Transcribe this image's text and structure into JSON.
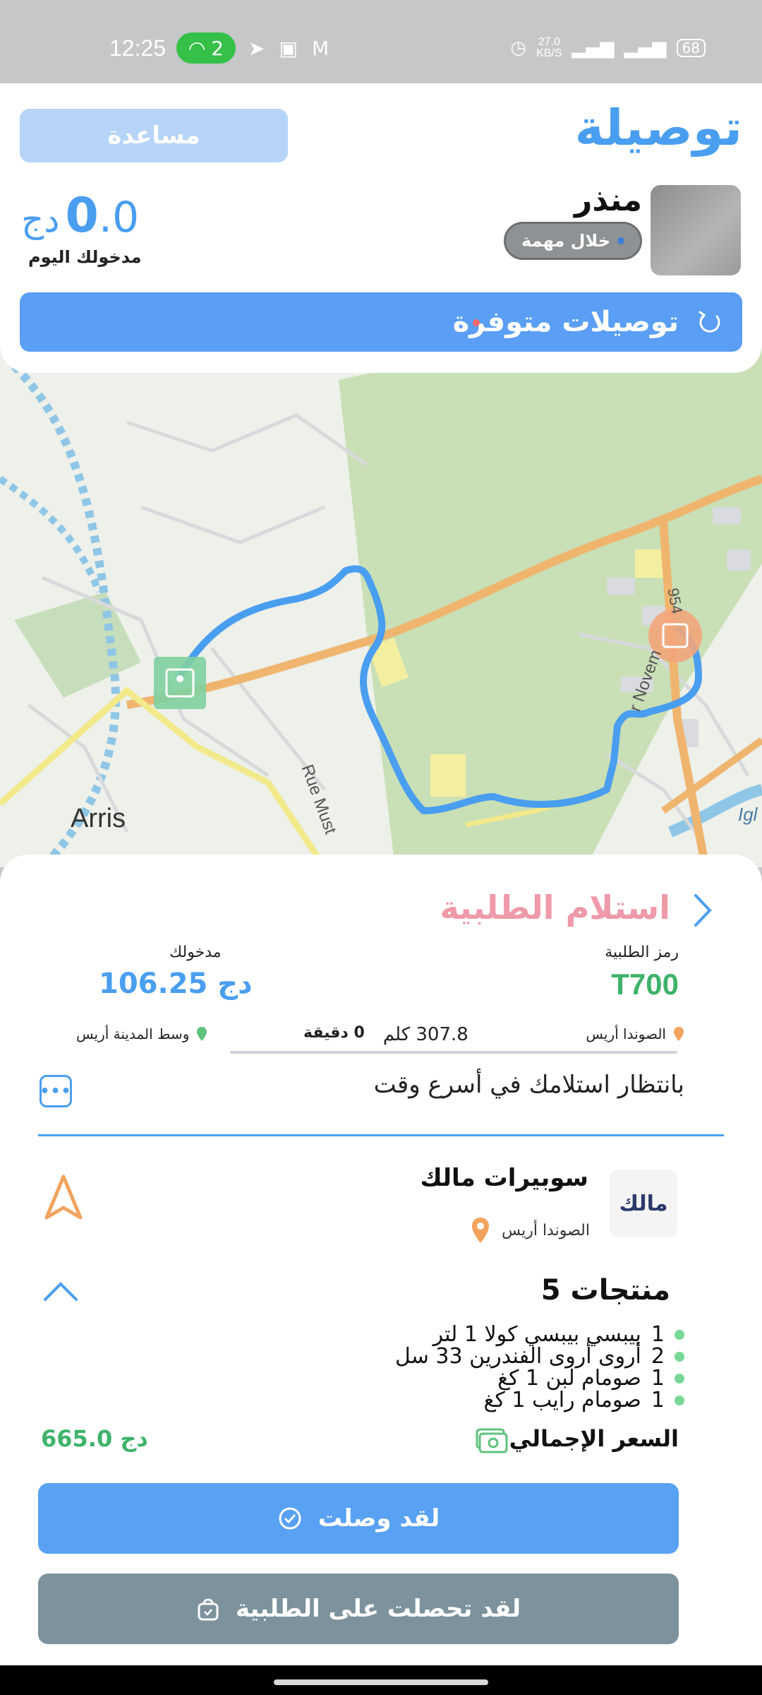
{
  "status_bar": {
    "time": "12:25",
    "hotspot_count": "2",
    "net_speed": "27.0",
    "net_unit": "KB/S",
    "battery": "68"
  },
  "header": {
    "app_title": "توصيلة",
    "help_button": "مساعدة",
    "driver_name": "منذر",
    "driver_status": "خلال مهمة",
    "earnings_today_value": "0",
    "earnings_today_decimal": ".0",
    "earnings_currency": "دج",
    "earnings_today_label": "مدخولك اليوم",
    "available_deliveries": "توصيلات متوفرة"
  },
  "map": {
    "city_label": "Arris",
    "street_labels": [
      "Rue Must",
      "r Novem",
      "954",
      "Igl"
    ]
  },
  "order": {
    "title": "استلام الطلبية",
    "code_label": "رمز الطلبية",
    "code": "T700",
    "earning_label": "مدخولك",
    "earning_value": "106.25",
    "earning_currency": "دج",
    "from_location": "الصوندا أريس",
    "to_location": "وسط المدينة أريس",
    "distance": "307.8 كلم",
    "duration": "0 دقيقة",
    "progress": 0,
    "waiting_message": "بانتظار استلامك في أسرع وقت",
    "store_name": "سوبيرات مالك",
    "store_logo_text": "مالك",
    "store_location": "الصوندا أريس",
    "products_title": "5 منتجات",
    "products": [
      {
        "qty": "1",
        "name": "بيبسي بيبسي كولا 1 لتر"
      },
      {
        "qty": "2",
        "name": "أروى أروى الفندرين 33 سل"
      },
      {
        "qty": "1",
        "name": "صومام لبن 1 كغ"
      },
      {
        "qty": "1",
        "name": "صومام رايب 1 كغ"
      }
    ],
    "total_label": "السعر الإجمالي",
    "total_value": "665.0",
    "total_currency": "دج"
  },
  "actions": {
    "arrived": "لقد وصلت",
    "got_order": "لقد تحصلت على الطلبية"
  },
  "colors": {
    "primary": "#4a9ef0",
    "green": "#3fb36a",
    "pink": "#ee9aa8",
    "grey_button": "#7d929c"
  },
  "icons": [
    "wifi-hotspot-icon",
    "telegram-icon",
    "gallery-icon",
    "gmail-icon",
    "alarm-icon",
    "signal-icon",
    "battery-icon",
    "refresh-icon",
    "back-chevron-icon",
    "location-pin-icon",
    "chat-icon",
    "navigate-arrow-icon",
    "chevron-up-icon",
    "cash-icon",
    "check-badge-icon",
    "bag-icon"
  ]
}
